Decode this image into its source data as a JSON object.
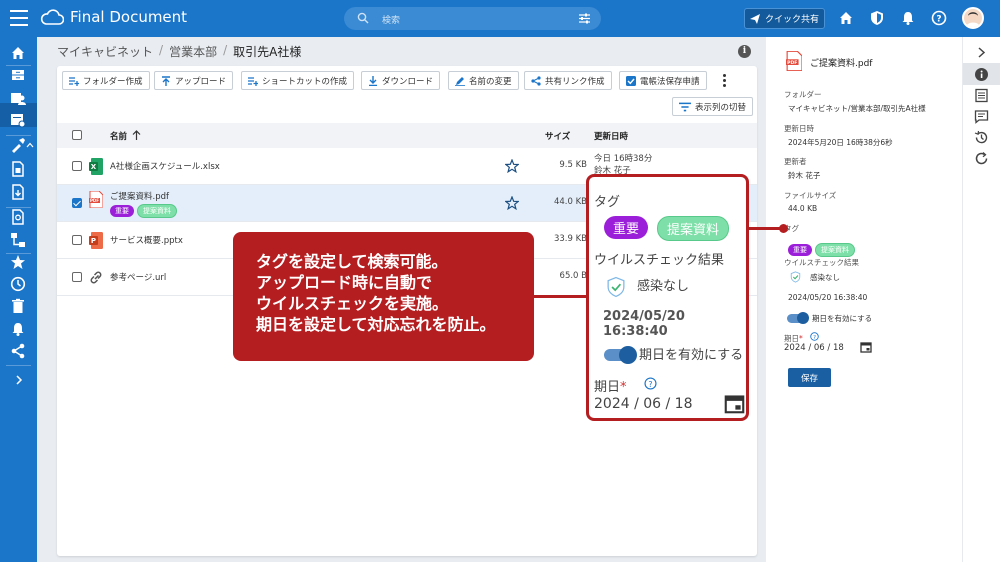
{
  "app": {
    "title": "Final Document",
    "search_placeholder": "検索",
    "quick_share_label": "クイック共有",
    "brand_color": "#1b75c9"
  },
  "breadcrumb": [
    "マイキャビネット",
    "営業本部",
    "取引先A社様"
  ],
  "toolbar": {
    "create_folder": "フォルダー作成",
    "upload": "アップロード",
    "create_shortcut": "ショートカットの作成",
    "download": "ダウンロード",
    "rename": "名前の変更",
    "share_link": "共有リンク作成",
    "ebook_request": "電帳法保存申請",
    "columns": "表示列の切替"
  },
  "table": {
    "headers": {
      "name": "名前",
      "size": "サイズ",
      "modified": "更新日時"
    },
    "rows": [
      {
        "name": "A社様企画スケジュール.xlsx",
        "size": "9.5 KB",
        "date": "今日 16時38分",
        "user": "鈴木 花子",
        "type": "xlsx"
      },
      {
        "name": "ご提案資料.pdf",
        "size": "44.0 KB",
        "type": "pdf",
        "tags": [
          "重要",
          "提案資料"
        ]
      },
      {
        "name": "サービス概要.pptx",
        "size": "33.9 KB",
        "type": "pptx"
      },
      {
        "name": "参考ページ.url",
        "size": "65.0 B",
        "type": "url"
      }
    ]
  },
  "detail": {
    "file_name": "ご提案資料.pdf",
    "folder_label": "フォルダー",
    "folder_value": "マイキャビネット/営業本部/取引先A社様",
    "updated_label": "更新日時",
    "updated_value": "2024年5月20日 16時38分6秒",
    "updater_label": "更新者",
    "updater_value": "鈴木 花子",
    "size_label": "ファイルサイズ",
    "size_value": "44.0 KB",
    "tag_label": "タグ",
    "tags": [
      "重要",
      "提案資料"
    ],
    "virus_label": "ウイルスチェック結果",
    "virus_value": "感染なし",
    "virus_time": "2024/05/20 16:38:40",
    "due_toggle_label": "期日を有効にする",
    "due_label": "期日",
    "due_required": "*",
    "due_value": "2024 / 06 / 18",
    "save_label": "保存"
  },
  "callout": {
    "lines": [
      "タグを設定して検索可能。",
      "アップロード時に自動で",
      "ウイルスチェックを実施。",
      "期日を設定して対応忘れを防止。"
    ]
  },
  "zoom": {
    "tag_label": "タグ",
    "tags": [
      "重要",
      "提案資料"
    ],
    "virus_label": "ウイルスチェック結果",
    "virus_value": "感染なし",
    "virus_time": "2024/05/20 16:38:40",
    "toggle_label": "期日を有効にする",
    "due_label": "期日",
    "due_required": "*",
    "due_value": "2024 / 06 / 18"
  }
}
